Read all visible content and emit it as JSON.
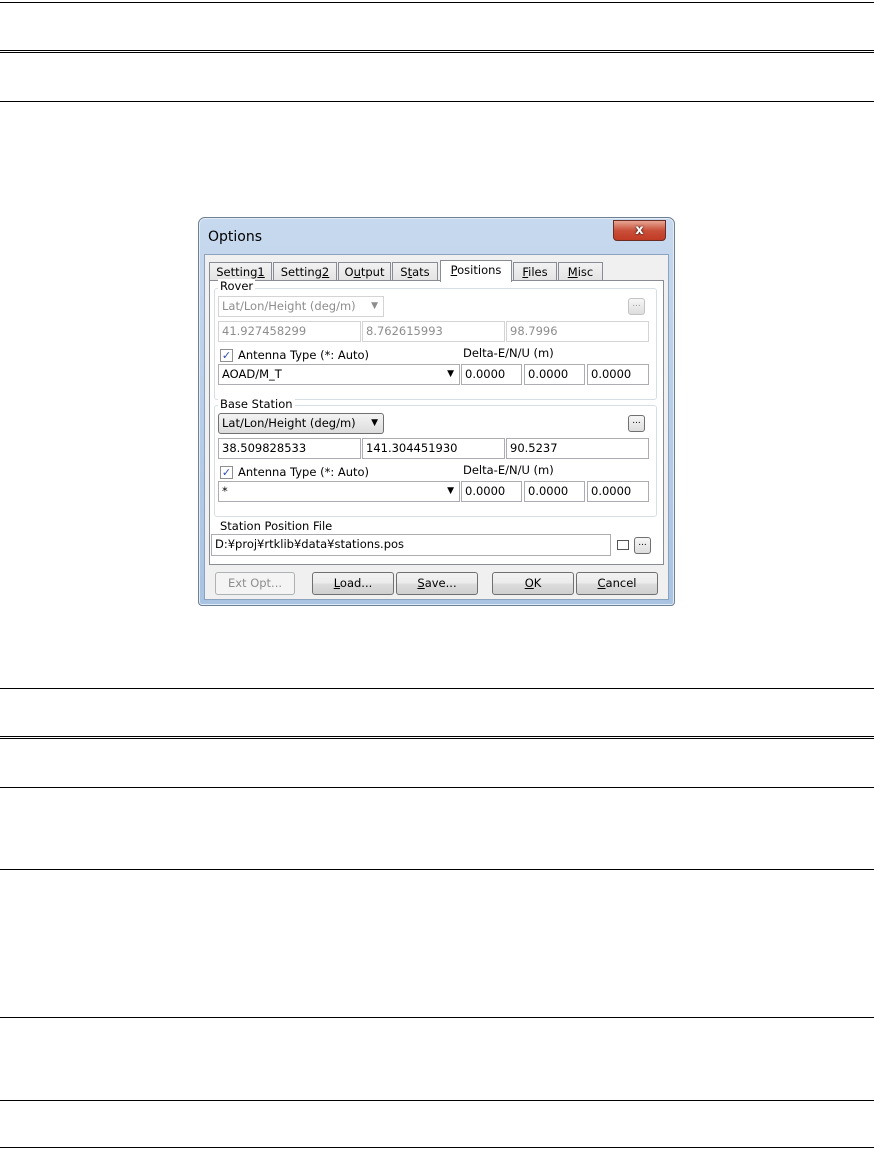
{
  "dialog": {
    "title": "Options",
    "close_glyph": "x",
    "tabs": [
      {
        "pre": "Setting",
        "acc": "1",
        "post": ""
      },
      {
        "pre": "Setting",
        "acc": "2",
        "post": ""
      },
      {
        "pre": "O",
        "acc": "u",
        "post": "tput"
      },
      {
        "pre": "S",
        "acc": "t",
        "post": "ats"
      },
      {
        "pre": "",
        "acc": "P",
        "post": "ositions"
      },
      {
        "pre": "",
        "acc": "F",
        "post": "iles"
      },
      {
        "pre": "",
        "acc": "M",
        "post": "isc"
      }
    ],
    "rover": {
      "label": "Rover",
      "pos_type": "Lat/Lon/Height (deg/m)",
      "lat": "41.927458299",
      "lon": "8.762615993",
      "height": "98.7996",
      "ant_check_label": "Antenna Type (*: Auto)",
      "delta_label": "Delta-E/N/U (m)",
      "antenna": "AOAD/M_T",
      "de": "0.0000",
      "dn": "0.0000",
      "du": "0.0000"
    },
    "base": {
      "label": "Base Station",
      "pos_type": "Lat/Lon/Height (deg/m)",
      "lat": "38.509828533",
      "lon": "141.304451930",
      "height": "90.5237",
      "ant_check_label": "Antenna Type (*: Auto)",
      "delta_label": "Delta-E/N/U (m)",
      "antenna": "*",
      "de": "0.0000",
      "dn": "0.0000",
      "du": "0.0000"
    },
    "station_file_label": "Station Position File",
    "station_file": "D:¥proj¥rtklib¥data¥stations.pos",
    "buttons": {
      "ext_opt": "Ext Opt...",
      "load_acc": "L",
      "load_post": "oad...",
      "save_acc": "S",
      "save_post": "ave...",
      "ok_acc": "O",
      "ok_post": "K",
      "cancel_acc": "C",
      "cancel_post": "ancel"
    },
    "ellipsis": "..."
  }
}
